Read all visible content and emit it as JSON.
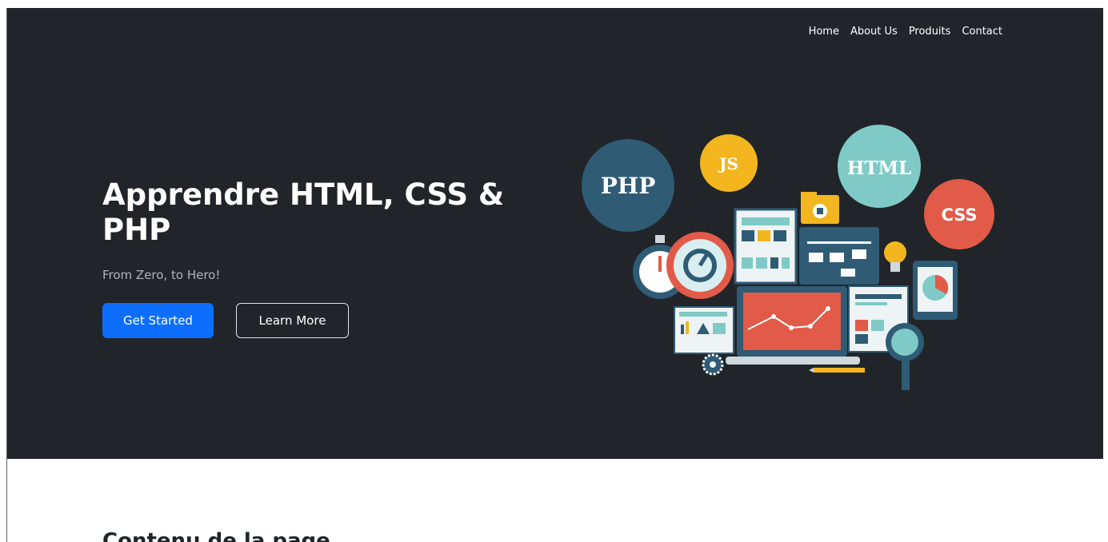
{
  "nav": {
    "items": [
      {
        "label": "Home"
      },
      {
        "label": "About Us"
      },
      {
        "label": "Produits"
      },
      {
        "label": "Contact"
      }
    ]
  },
  "hero": {
    "title": "Apprendre HTML, CSS & PHP",
    "subtitle": "From Zero, to Hero!",
    "primary_button": "Get Started",
    "secondary_button": "Learn More",
    "illustration_labels": {
      "php": "PHP",
      "js": "JS",
      "html": "HTML",
      "css": "CSS"
    }
  },
  "content": {
    "section_title": "Contenu de la page"
  },
  "colors": {
    "hero_bg": "#212529",
    "primary": "#0d6efd",
    "php_bubble": "#2f5b75",
    "js_bubble": "#f3b61f",
    "html_bubble": "#7fcac6",
    "css_bubble": "#e25a48"
  }
}
